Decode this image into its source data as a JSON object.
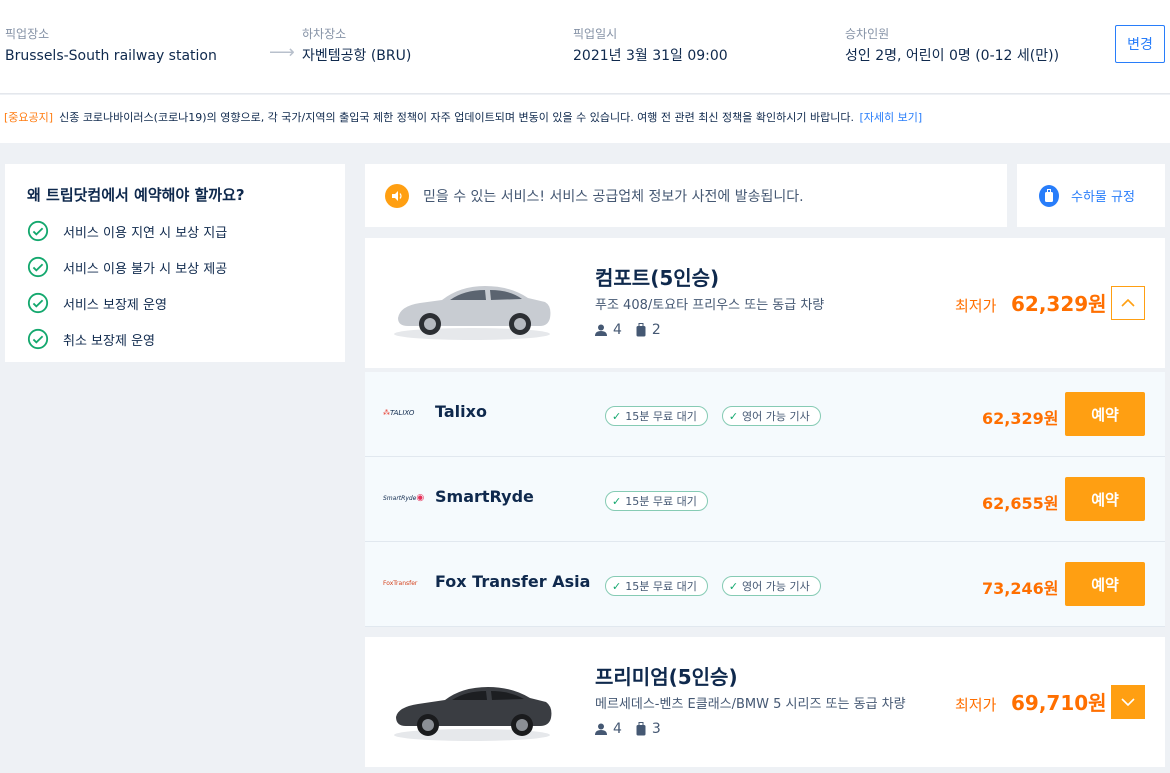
{
  "search": {
    "pickup_label": "픽업장소",
    "pickup_value": "Brussels-South railway station",
    "dropoff_label": "하차장소",
    "dropoff_value": "자벤템공항 (BRU)",
    "datetime_label": "픽업일시",
    "datetime_value": "2021년 3월 31일 09:00",
    "passengers_label": "승차인원",
    "passengers_value": "성인 2명, 어린이 0명 (0-12 세(만))",
    "change_button": "변경"
  },
  "notice": {
    "tag": "[중요공지]",
    "text": "신종 코로나바이러스(코로나19)의 영향으로, 각 국가/지역의 출입국 제한 정책이 자주 업데이트되며 변동이 있을 수 있습니다. 여행 전 관련 최신 정책을 확인하시기 바랍니다.",
    "link": "[자세히 보기]"
  },
  "sidebar": {
    "title": "왜 트립닷컴에서 예약해야 할까요?",
    "benefits": [
      "서비스 이용 지연 시 보상 지급",
      "서비스 이용 불가 시 보상 제공",
      "서비스 보장제 운영",
      "취소 보장제 운영"
    ]
  },
  "info_bar": {
    "text": "믿을 수 있는 서비스! 서비스 공급업체 정보가 사전에 발송됩니다.",
    "baggage_link": "수하물 규정"
  },
  "cars": [
    {
      "name": "컴포트(5인승)",
      "desc": "푸조 408/토요타 프리우스 또는 동급 차량",
      "seats": "4",
      "bags": "2",
      "lowest_label": "최저가",
      "lowest_price": "62,329원",
      "color": "#c8ccd2"
    },
    {
      "name": "프리미엄(5인승)",
      "desc": "메르세데스-벤츠 E클래스/BMW 5 시리즈 또는 동급 차량",
      "seats": "4",
      "bags": "3",
      "lowest_label": "최저가",
      "lowest_price": "69,710원",
      "color": "#3a3d42"
    }
  ],
  "suppliers": [
    {
      "name": "Talixo",
      "logo": "TALIXO",
      "badges": [
        "15분 무료 대기",
        "영어 가능 기사"
      ],
      "price": "62,329원",
      "book": "예약"
    },
    {
      "name": "SmartRyde",
      "logo": "SmartRyde",
      "badges": [
        "15분 무료 대기"
      ],
      "price": "62,655원",
      "book": "예약"
    },
    {
      "name": "Fox Transfer Asia",
      "logo": "FoxTransfer",
      "badges": [
        "15분 무료 대기",
        "영어 가능 기사"
      ],
      "price": "73,246원",
      "book": "예약"
    }
  ],
  "colors": {
    "accent": "#ff9f12",
    "price": "#ff6f00",
    "link": "#287dfa"
  }
}
